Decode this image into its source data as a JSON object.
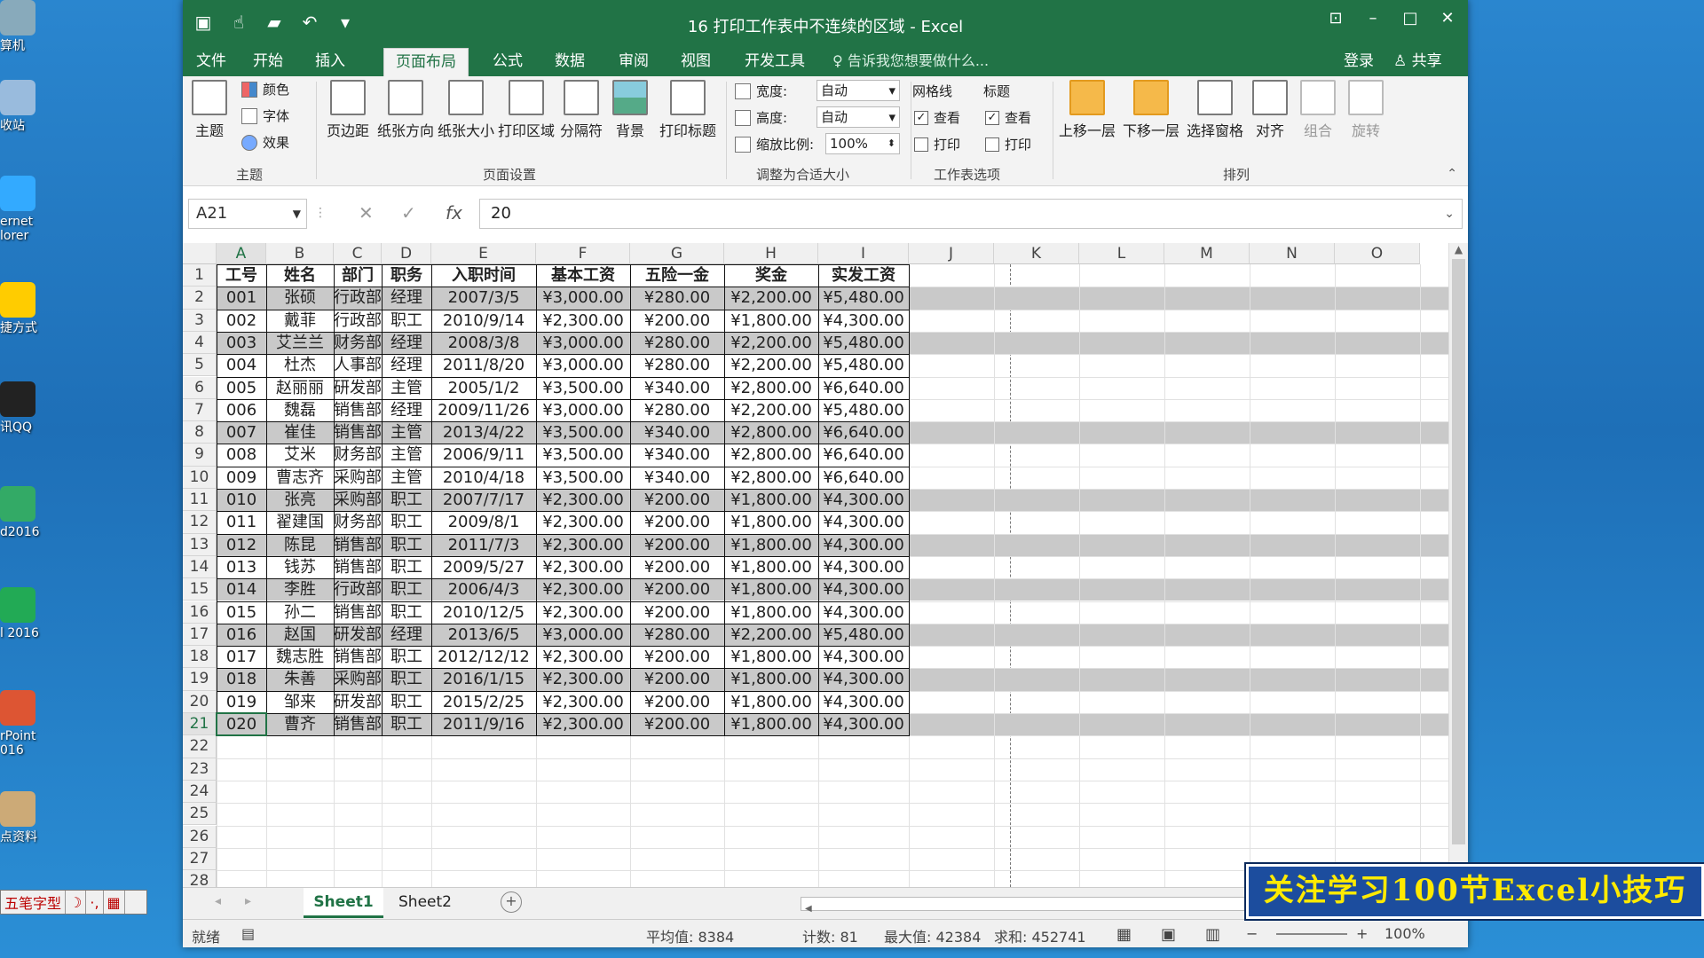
{
  "desktop": {
    "icons": [
      {
        "label": "算机"
      },
      {
        "label": "收站"
      },
      {
        "label": "ernet\nlorer"
      },
      {
        "label": "捷方式"
      },
      {
        "label": "讯QQ"
      },
      {
        "label": "d2016"
      },
      {
        "label": "l 2016"
      },
      {
        "label": "rPoint\n016"
      },
      {
        "label": "点资料"
      }
    ],
    "ime": [
      "五笔字型",
      "☽",
      "·,",
      "▦"
    ]
  },
  "window": {
    "title": "16 打印工作表中不连续的区域 - Excel",
    "tabs": [
      "文件",
      "开始",
      "插入",
      "页面布局",
      "公式",
      "数据",
      "审阅",
      "视图",
      "开发工具"
    ],
    "active_tab": "页面布局",
    "tell_me": "告诉我您想要做什么...",
    "login": "登录",
    "share": "共享"
  },
  "ribbon": {
    "theme": {
      "big": "主题",
      "colors": "颜色",
      "fonts": "字体",
      "effects": "效果",
      "group": "主题"
    },
    "page_setup": {
      "buttons": [
        "页边距",
        "纸张方向",
        "纸张大小",
        "打印区域",
        "分隔符",
        "背景",
        "打印标题"
      ],
      "group": "页面设置"
    },
    "scale": {
      "width_label": "宽度:",
      "width_value": "自动",
      "height_label": "高度:",
      "height_value": "自动",
      "scale_label": "缩放比例:",
      "scale_value": "100%",
      "group": "调整为合适大小"
    },
    "sheet_options": {
      "gridlines": "网格线",
      "headings": "标题",
      "view": "查看",
      "print": "打印",
      "group": "工作表选项"
    },
    "arrange": {
      "buttons": [
        "上移一层",
        "下移一层",
        "选择窗格",
        "对齐",
        "组合",
        "旋转"
      ],
      "group": "排列"
    }
  },
  "formula_bar": {
    "name_box": "A21",
    "formula": "20"
  },
  "columns": [
    "A",
    "B",
    "C",
    "D",
    "E",
    "F",
    "G",
    "H",
    "I",
    "J",
    "K",
    "L",
    "M",
    "N",
    "O"
  ],
  "row_numbers": [
    "1",
    "2",
    "3",
    "4",
    "5",
    "6",
    "7",
    "8",
    "9",
    "10",
    "11",
    "12",
    "13",
    "14",
    "15",
    "16",
    "17",
    "18",
    "19",
    "20",
    "21",
    "22",
    "23",
    "24",
    "25",
    "26",
    "27",
    "28"
  ],
  "table": {
    "headers": [
      "工号",
      "姓名",
      "部门",
      "职务",
      "入职时间",
      "基本工资",
      "五险一金",
      "奖金",
      "实发工资"
    ],
    "rows": [
      [
        "001",
        "张硕",
        "行政部",
        "经理",
        "2007/3/5",
        "¥3,000.00",
        "¥280.00",
        "¥2,200.00",
        "¥5,480.00"
      ],
      [
        "002",
        "戴菲",
        "行政部",
        "职工",
        "2010/9/14",
        "¥2,300.00",
        "¥200.00",
        "¥1,800.00",
        "¥4,300.00"
      ],
      [
        "003",
        "艾兰兰",
        "财务部",
        "经理",
        "2008/3/8",
        "¥3,000.00",
        "¥280.00",
        "¥2,200.00",
        "¥5,480.00"
      ],
      [
        "004",
        "杜杰",
        "人事部",
        "经理",
        "2011/8/20",
        "¥3,000.00",
        "¥280.00",
        "¥2,200.00",
        "¥5,480.00"
      ],
      [
        "005",
        "赵丽丽",
        "研发部",
        "主管",
        "2005/1/2",
        "¥3,500.00",
        "¥340.00",
        "¥2,800.00",
        "¥6,640.00"
      ],
      [
        "006",
        "魏磊",
        "销售部",
        "经理",
        "2009/11/26",
        "¥3,000.00",
        "¥280.00",
        "¥2,200.00",
        "¥5,480.00"
      ],
      [
        "007",
        "崔佳",
        "销售部",
        "主管",
        "2013/4/22",
        "¥3,500.00",
        "¥340.00",
        "¥2,800.00",
        "¥6,640.00"
      ],
      [
        "008",
        "艾米",
        "财务部",
        "主管",
        "2006/9/11",
        "¥3,500.00",
        "¥340.00",
        "¥2,800.00",
        "¥6,640.00"
      ],
      [
        "009",
        "曹志齐",
        "采购部",
        "主管",
        "2010/4/18",
        "¥3,500.00",
        "¥340.00",
        "¥2,800.00",
        "¥6,640.00"
      ],
      [
        "010",
        "张亮",
        "采购部",
        "职工",
        "2007/7/17",
        "¥2,300.00",
        "¥200.00",
        "¥1,800.00",
        "¥4,300.00"
      ],
      [
        "011",
        "翟建国",
        "财务部",
        "职工",
        "2009/8/1",
        "¥2,300.00",
        "¥200.00",
        "¥1,800.00",
        "¥4,300.00"
      ],
      [
        "012",
        "陈昆",
        "销售部",
        "职工",
        "2011/7/3",
        "¥2,300.00",
        "¥200.00",
        "¥1,800.00",
        "¥4,300.00"
      ],
      [
        "013",
        "钱苏",
        "销售部",
        "职工",
        "2009/5/27",
        "¥2,300.00",
        "¥200.00",
        "¥1,800.00",
        "¥4,300.00"
      ],
      [
        "014",
        "李胜",
        "行政部",
        "职工",
        "2006/4/3",
        "¥2,300.00",
        "¥200.00",
        "¥1,800.00",
        "¥4,300.00"
      ],
      [
        "015",
        "孙二",
        "销售部",
        "职工",
        "2010/12/5",
        "¥2,300.00",
        "¥200.00",
        "¥1,800.00",
        "¥4,300.00"
      ],
      [
        "016",
        "赵国",
        "研发部",
        "经理",
        "2013/6/5",
        "¥3,000.00",
        "¥280.00",
        "¥2,200.00",
        "¥5,480.00"
      ],
      [
        "017",
        "魏志胜",
        "销售部",
        "职工",
        "2012/12/12",
        "¥2,300.00",
        "¥200.00",
        "¥1,800.00",
        "¥4,300.00"
      ],
      [
        "018",
        "朱善",
        "采购部",
        "职工",
        "2016/1/15",
        "¥2,300.00",
        "¥200.00",
        "¥1,800.00",
        "¥4,300.00"
      ],
      [
        "019",
        "邹来",
        "研发部",
        "职工",
        "2015/2/25",
        "¥2,300.00",
        "¥200.00",
        "¥1,800.00",
        "¥4,300.00"
      ],
      [
        "020",
        "曹齐",
        "销售部",
        "职工",
        "2011/9/16",
        "¥2,300.00",
        "¥200.00",
        "¥1,800.00",
        "¥4,300.00"
      ]
    ],
    "highlighted_rows": [
      2,
      4,
      8,
      11,
      13,
      15,
      17,
      19,
      21
    ],
    "highlight_color": "#c9c9c9"
  },
  "sheet_tabs": [
    "Sheet1",
    "Sheet2"
  ],
  "active_sheet": "Sheet1",
  "status": {
    "ready": "就绪",
    "average": "平均值: 8384",
    "count": "计数: 81",
    "max": "最大值: 42384",
    "sum": "求和: 452741",
    "zoom": "100%"
  },
  "banner": {
    "text": "关注学习100节Excel小技巧"
  },
  "colors": {
    "excel_green": "#217346",
    "banner_bg": "#1c4d9e",
    "banner_text": "#ffea00"
  }
}
